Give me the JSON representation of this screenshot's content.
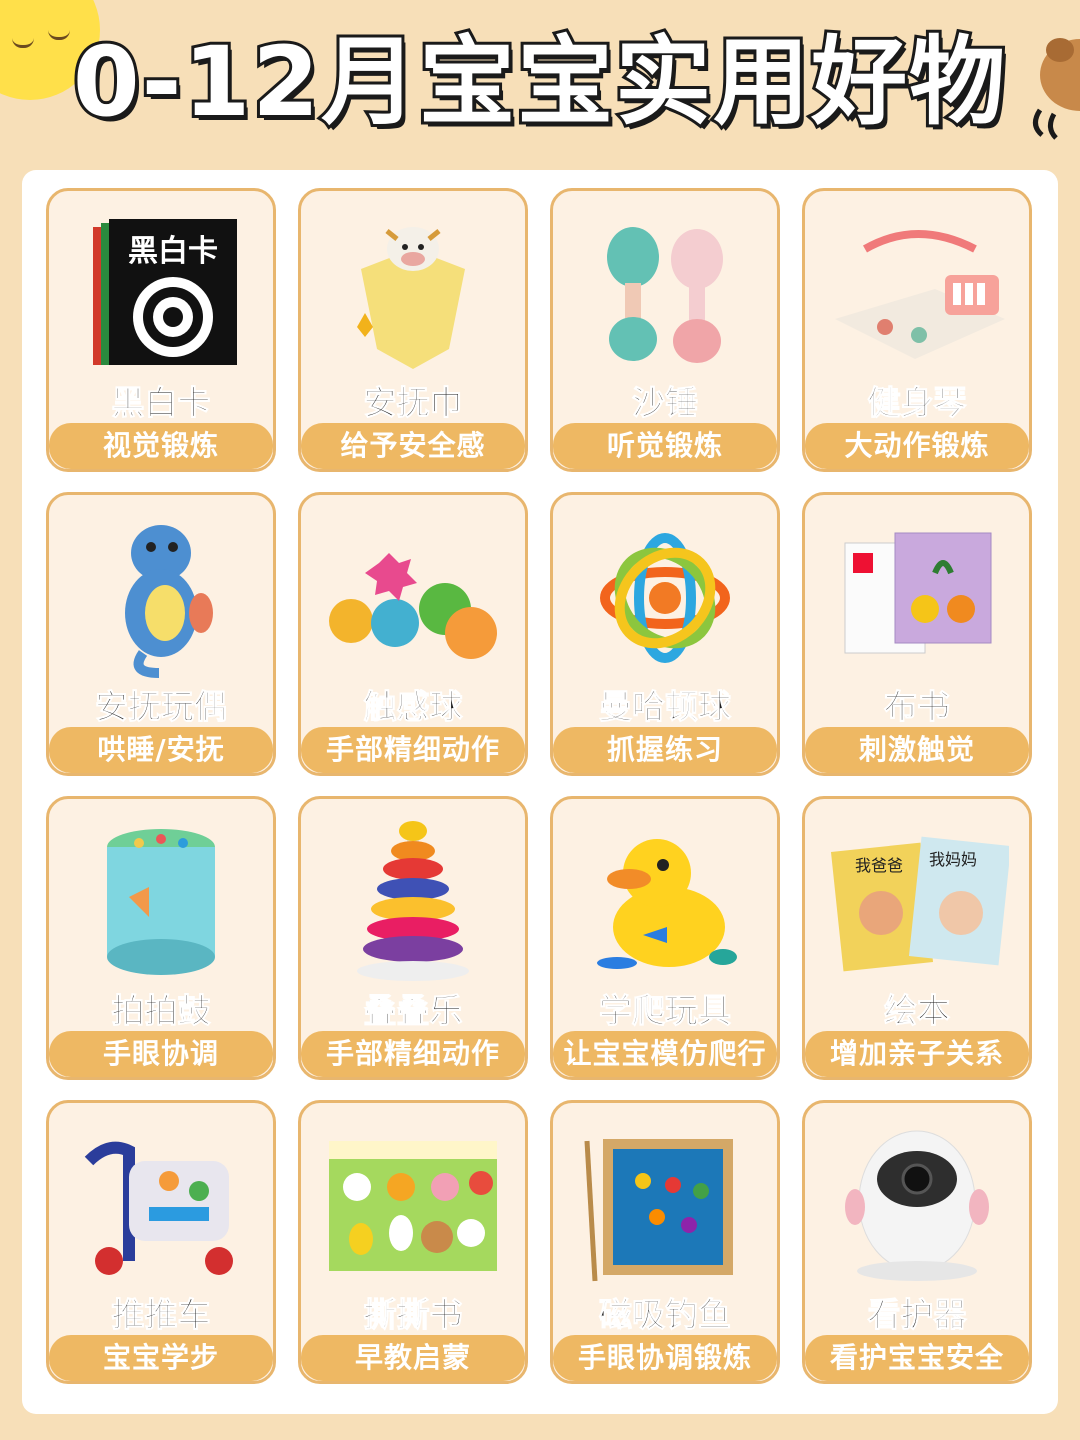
{
  "title": "0-12月宝宝实用好物",
  "items": [
    {
      "name": "黑白卡",
      "benefit": "视觉锻炼",
      "icon": "black-white-cards-icon",
      "card_text": "黑白卡"
    },
    {
      "name": "安抚巾",
      "benefit": "给予安全感",
      "icon": "comfort-blanket-icon"
    },
    {
      "name": "沙锤",
      "benefit": "听觉锻炼",
      "icon": "maracas-icon"
    },
    {
      "name": "健身琴",
      "benefit": "大动作锻炼",
      "icon": "play-gym-icon"
    },
    {
      "name": "安抚玩偶",
      "benefit": "哄睡/安抚",
      "icon": "seahorse-plush-icon"
    },
    {
      "name": "触感球",
      "benefit": "手部精细动作",
      "icon": "sensory-balls-icon"
    },
    {
      "name": "曼哈顿球",
      "benefit": "抓握练习",
      "icon": "manhattan-ball-icon"
    },
    {
      "name": "布书",
      "benefit": "刺激触觉",
      "icon": "cloth-book-icon"
    },
    {
      "name": "拍拍鼓",
      "benefit": "手眼协调",
      "icon": "pat-drum-icon"
    },
    {
      "name": "叠叠乐",
      "benefit": "手部精细动作",
      "icon": "stacking-rings-icon"
    },
    {
      "name": "学爬玩具",
      "benefit": "让宝宝模仿爬行",
      "icon": "crawling-duck-icon"
    },
    {
      "name": "绘本",
      "benefit": "增加亲子关系",
      "icon": "picture-books-icon",
      "book_titles": [
        "我爸爸",
        "我妈妈"
      ]
    },
    {
      "name": "推推车",
      "benefit": "宝宝学步",
      "icon": "baby-walker-icon"
    },
    {
      "name": "撕撕书",
      "benefit": "早教启蒙",
      "icon": "sticker-book-icon"
    },
    {
      "name": "磁吸钓鱼",
      "benefit": "手眼协调锻炼",
      "icon": "magnetic-fishing-icon"
    },
    {
      "name": "看护器",
      "benefit": "看护宝宝安全",
      "icon": "baby-monitor-icon"
    }
  ],
  "colors": {
    "background": "#f7dfb8",
    "card": "#fdf1e3",
    "pill": "#eeb863",
    "border": "#e8b66e"
  }
}
